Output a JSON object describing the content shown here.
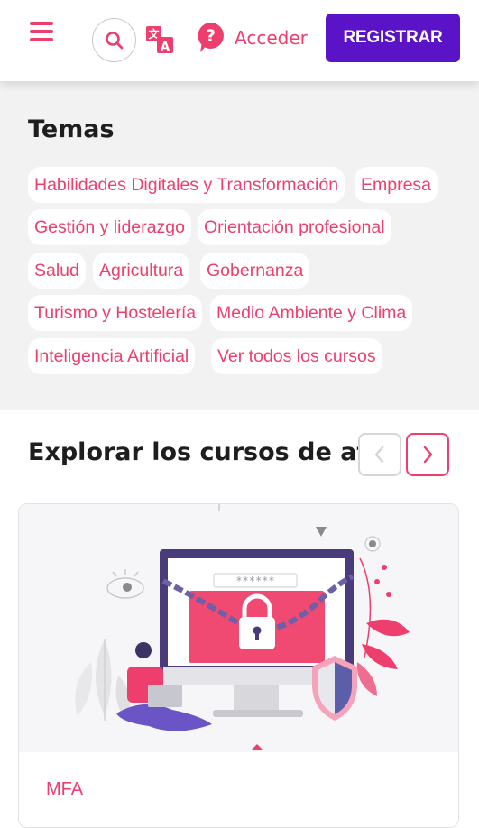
{
  "header": {
    "login_label": "Acceder",
    "register_label": "REGISTRAR",
    "icons": [
      "menu-icon",
      "search-icon",
      "translate-icon",
      "help-icon"
    ],
    "colors": {
      "accent": "#ee3e6d",
      "primary": "#5b13c8"
    }
  },
  "topics": {
    "title": "Temas",
    "chips": [
      "Habilidades Digitales y Transformación",
      "Empresa",
      "Gestión y liderazgo",
      "Orientación profesional",
      "Salud",
      "Agricultura",
      "Gobernanza",
      "Turismo y Hostelería",
      "Medio Ambiente y Clima",
      "Inteligencia Artificial",
      "Ver todos los cursos"
    ]
  },
  "explore": {
    "title": "Explorar los cursos de atinacademy"
  },
  "card": {
    "illustration": "cybersecurity-lock-monitor",
    "password_mask": "******",
    "label": "MFA"
  }
}
